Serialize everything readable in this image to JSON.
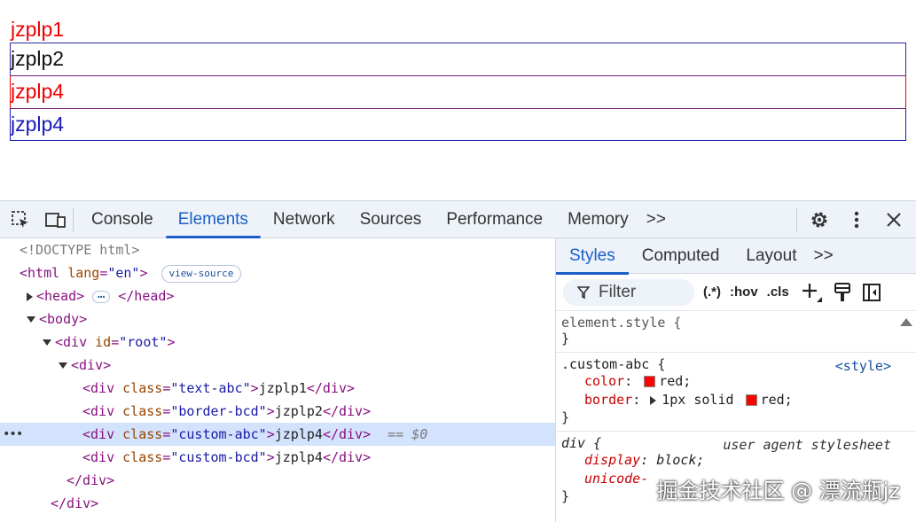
{
  "preview": {
    "lines": [
      "jzplp1",
      "jzplp2",
      "jzplp4",
      "jzplp4"
    ]
  },
  "devtools": {
    "tabs": [
      "Console",
      "Elements",
      "Network",
      "Sources",
      "Performance",
      "Memory"
    ],
    "more": ">>",
    "dom": {
      "doctype": "<!DOCTYPE html>",
      "html_open": "<html",
      "html_attr": "lang",
      "html_val": "\"en\"",
      "view_source": "view-source",
      "head_open": "<head>",
      "head_close": "</head>",
      "ellipsis": "…",
      "body_open": "<body>",
      "div_root_open": "<div",
      "div_root_attr": "id",
      "div_root_val": "\"root\"",
      "gt": ">",
      "div_open": "<div>",
      "div_close": "</div>",
      "children": [
        {
          "cls": "\"text-abc\"",
          "text": "jzplp1"
        },
        {
          "cls": "\"border-bcd\"",
          "text": "jzplp2"
        },
        {
          "cls": "\"custom-abc\"",
          "text": "jzplp4"
        },
        {
          "cls": "\"custom-bcd\"",
          "text": "jzplp4"
        }
      ],
      "child_open": "<div",
      "class_attr": "class",
      "eq_label": "== $0",
      "row_dots": "•••"
    },
    "styles": {
      "subtabs": [
        "Styles",
        "Computed",
        "Layout"
      ],
      "more": ">>",
      "filter": "Filter",
      "regex": "(.*)",
      "hov": ":hov",
      "cls": ".cls",
      "element_style": "element.style {",
      "close_brace": "}",
      "rule1_selector": ".custom-abc {",
      "rule1_src": "<style>",
      "rule1_color_prop": "color",
      "rule1_color_val": "red;",
      "rule1_border_prop": "border",
      "rule1_border_pre": "1px solid",
      "rule1_border_val": "red;",
      "rule2_selector": "div {",
      "rule2_src": "user agent stylesheet",
      "rule2_display_prop": "display",
      "rule2_display_val": "block;",
      "rule2_unicode_prop": "unicode-",
      "swatch_color": "#ff0000"
    },
    "watermark": "掘金技术社区 @ 漂流瓶jz"
  }
}
